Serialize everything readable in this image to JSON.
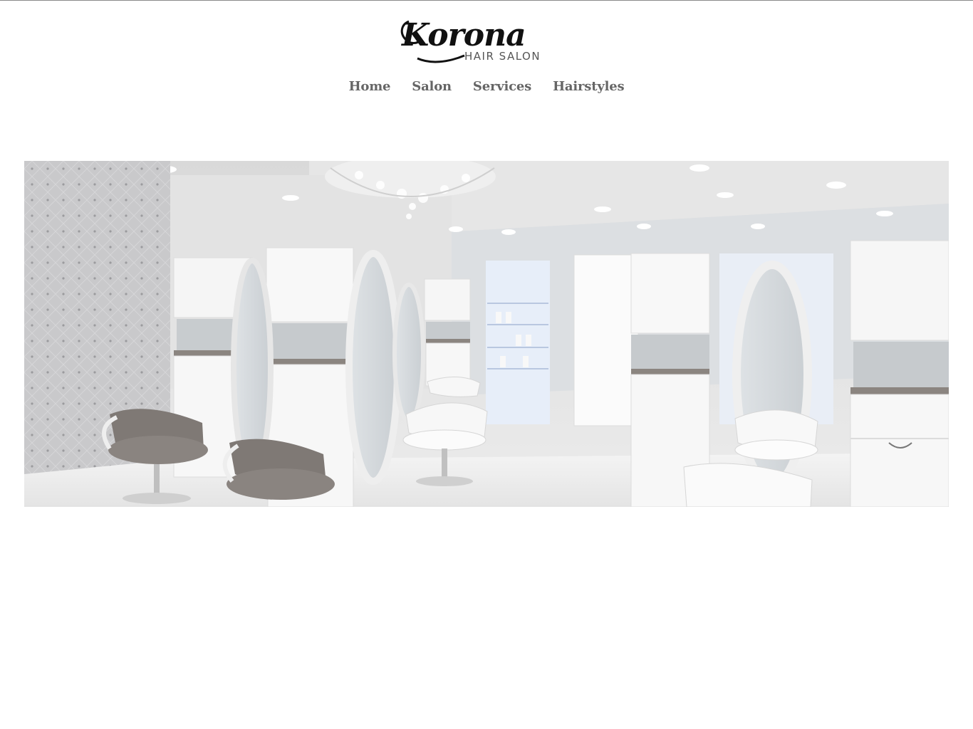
{
  "brand": {
    "name": "Korona",
    "tagline": "HAIR SALON"
  },
  "nav": {
    "items": [
      {
        "label": "Home"
      },
      {
        "label": "Salon"
      },
      {
        "label": "Services"
      },
      {
        "label": "Hairstyles"
      }
    ]
  },
  "hero": {
    "icon": "salon-interior-photo"
  },
  "colors": {
    "nav_text": "#666666",
    "logo_black": "#111111",
    "tagline_gray": "#555555"
  }
}
